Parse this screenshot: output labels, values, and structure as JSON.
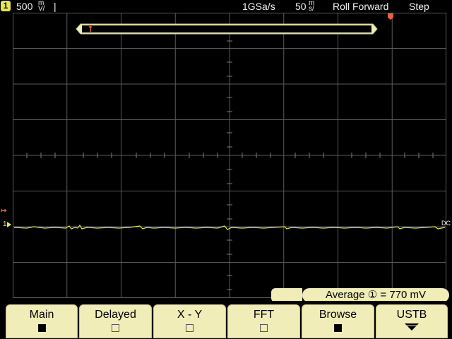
{
  "status_bar": {
    "channel": "1",
    "v_scale": "500",
    "v_unit_top": "m",
    "v_unit_bottom": "V/",
    "sample_rate": "1GSa/s",
    "timebase": "50",
    "t_unit_top": "m",
    "t_unit_bottom": "s/",
    "mode": "Roll Forward",
    "run_state": "Step"
  },
  "markers": {
    "trigger_left": "T",
    "ground_ch1": "1",
    "dc_label": "DC"
  },
  "measurement": {
    "label": "Average",
    "channel_symbol": "①",
    "value_text": "= 770 mV"
  },
  "softkeys": [
    {
      "label": "Main",
      "state": "on"
    },
    {
      "label": "Delayed",
      "state": "off"
    },
    {
      "label": "X - Y",
      "state": "off"
    },
    {
      "label": "FFT",
      "state": "off"
    },
    {
      "label": "Browse",
      "state": "on"
    },
    {
      "label": "USTB",
      "state": "more"
    }
  ],
  "colors": {
    "trace": "#e6e65a",
    "grid": "#5a5a5a",
    "softkey_bg": "#f0edb8",
    "trigger_marker": "#e8613a"
  }
}
